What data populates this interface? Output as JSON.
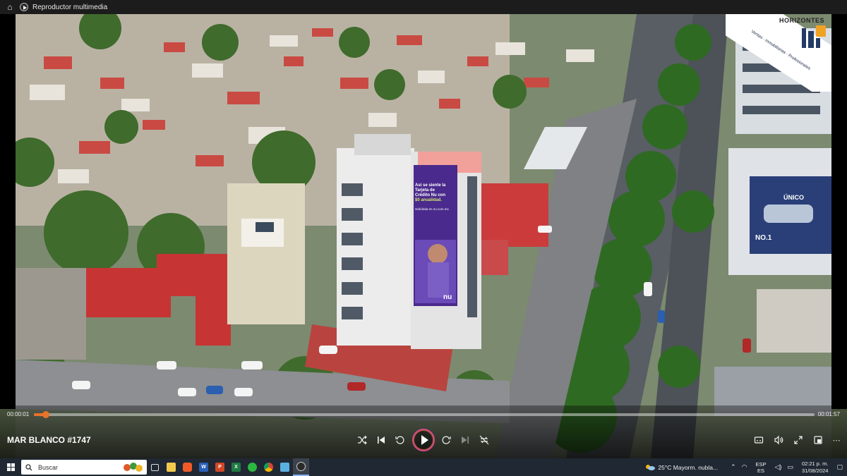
{
  "window": {
    "title": "Reproductor multimedia"
  },
  "video": {
    "title": "MAR BLANCO #1747",
    "current_time": "00:00:01",
    "duration": "00:01:57",
    "progress": 0.0085,
    "brand": {
      "name": "HORIZONTES",
      "tags": "Ventas · Inmobiliarias · Profesionales"
    },
    "billboard": {
      "line1": "Así se siente la",
      "line2": "Tarjeta de",
      "line3": "Crédito Nu con",
      "line4": "$0 anualidad.",
      "sub": "Solicítala en nu.com.mx",
      "brand": "nu"
    },
    "sign": {
      "top": "NO.1",
      "ad": "ÚNICO"
    }
  },
  "taskbar": {
    "search_placeholder": "Buscar",
    "weather": "25°C  Mayorm. nubla...",
    "lang_top": "ESP",
    "lang_bottom": "ES",
    "time": "02:21 p. m.",
    "date": "31/08/2024"
  },
  "colors": {
    "accent": "#e8722a",
    "play_ring": "#d94b8f",
    "taskbar": "#202833"
  }
}
